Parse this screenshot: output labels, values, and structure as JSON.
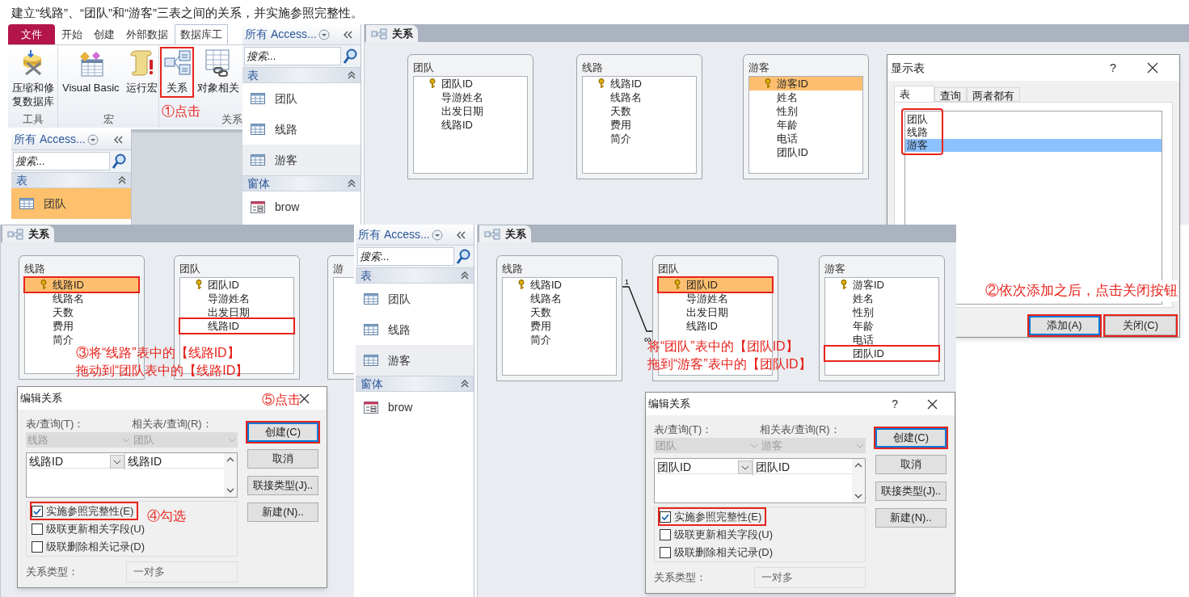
{
  "instruction": "建立“线路”、“团队”和“游客”三表之间的关系，并实施参照完整性。",
  "ribbon": {
    "tabs": [
      {
        "label": "文件",
        "kind": "file"
      },
      {
        "label": "开始",
        "kind": "tab",
        "selected": false
      },
      {
        "label": "创建",
        "kind": "tab",
        "selected": false
      },
      {
        "label": "外部数据",
        "kind": "tab",
        "selected": false
      },
      {
        "label": "数据库工",
        "kind": "tab",
        "selected": true
      }
    ],
    "groups": [
      {
        "label": "工具",
        "buttons": [
          {
            "label": "压缩和修复数据库",
            "kind": "compact",
            "highlighted": false
          }
        ]
      },
      {
        "label": "宏",
        "buttons": [
          {
            "label": "Visual Basic",
            "kind": "vb",
            "highlighted": false
          },
          {
            "label": "运行宏",
            "kind": "macro",
            "highlighted": false
          }
        ]
      },
      {
        "label": "关系",
        "buttons": [
          {
            "label": "关系",
            "kind": "relations",
            "highlighted": true
          },
          {
            "label": "对象相关",
            "kind": "dependencies",
            "highlighted": false
          }
        ]
      }
    ],
    "annotation": "①点击"
  },
  "nav_panes": [
    {
      "title": "所有 Access...",
      "search_placeholder": "搜索...",
      "sections": [
        {
          "label": "表",
          "items": [
            {
              "label": "团队",
              "kind": "table",
              "selected": true
            }
          ]
        }
      ]
    },
    {
      "title": "所有 Access...",
      "search_placeholder": "搜索...",
      "sections": [
        {
          "label": "表",
          "items": [
            {
              "label": "团队",
              "kind": "table",
              "selected": false,
              "hovered": false
            },
            {
              "label": "线路",
              "kind": "table",
              "selected": false,
              "hovered": false
            },
            {
              "label": "游客",
              "kind": "table",
              "selected": false,
              "hovered": true
            }
          ]
        },
        {
          "label": "窗体",
          "items": [
            {
              "label": "brow",
              "kind": "form",
              "selected": false,
              "hovered": false
            }
          ]
        }
      ]
    },
    {
      "title": "所有 Access...",
      "search_placeholder": "搜索...",
      "sections": [
        {
          "label": "表",
          "items": [
            {
              "label": "团队",
              "kind": "table",
              "selected": false,
              "hovered": false
            },
            {
              "label": "线路",
              "kind": "table",
              "selected": false,
              "hovered": false
            },
            {
              "label": "游客",
              "kind": "table",
              "selected": false,
              "hovered": true
            }
          ]
        },
        {
          "label": "窗体",
          "items": [
            {
              "label": "brow",
              "kind": "form",
              "selected": false,
              "hovered": false
            }
          ]
        }
      ]
    }
  ],
  "relationship_windows": [
    {
      "tab": "关系",
      "tables": [
        {
          "name": "团队",
          "fields": [
            {
              "label": "团队ID",
              "key": true,
              "selected": false,
              "highlighted": false
            },
            {
              "label": "导游姓名",
              "key": false,
              "selected": false,
              "highlighted": false
            },
            {
              "label": "出发日期",
              "key": false,
              "selected": false,
              "highlighted": false
            },
            {
              "label": "线路ID",
              "key": false,
              "selected": false,
              "highlighted": false
            }
          ]
        },
        {
          "name": "线路",
          "fields": [
            {
              "label": "线路ID",
              "key": true,
              "selected": false,
              "highlighted": false
            },
            {
              "label": "线路名",
              "key": false,
              "selected": false,
              "highlighted": false
            },
            {
              "label": "天数",
              "key": false,
              "selected": false,
              "highlighted": false
            },
            {
              "label": "费用",
              "key": false,
              "selected": false,
              "highlighted": false
            },
            {
              "label": "简介",
              "key": false,
              "selected": false,
              "highlighted": false
            }
          ]
        },
        {
          "name": "游客",
          "fields": [
            {
              "label": "游客ID",
              "key": true,
              "selected": true,
              "highlighted": false
            },
            {
              "label": "姓名",
              "key": false,
              "selected": false,
              "highlighted": false
            },
            {
              "label": "性别",
              "key": false,
              "selected": false,
              "highlighted": false
            },
            {
              "label": "年龄",
              "key": false,
              "selected": false,
              "highlighted": false
            },
            {
              "label": "电话",
              "key": false,
              "selected": false,
              "highlighted": false
            },
            {
              "label": "团队ID",
              "key": false,
              "selected": false,
              "highlighted": false
            }
          ]
        }
      ]
    },
    {
      "tab": "关系",
      "tables": [
        {
          "name": "线路",
          "fields": [
            {
              "label": "线路ID",
              "key": true,
              "selected": true,
              "highlighted": true
            },
            {
              "label": "线路名",
              "key": false,
              "selected": false,
              "highlighted": false
            },
            {
              "label": "天数",
              "key": false,
              "selected": false,
              "highlighted": false
            },
            {
              "label": "费用",
              "key": false,
              "selected": false,
              "highlighted": false
            },
            {
              "label": "简介",
              "key": false,
              "selected": false,
              "highlighted": false
            }
          ]
        },
        {
          "name": "团队",
          "fields": [
            {
              "label": "团队ID",
              "key": true,
              "selected": false,
              "highlighted": false
            },
            {
              "label": "导游姓名",
              "key": false,
              "selected": false,
              "highlighted": false
            },
            {
              "label": "出发日期",
              "key": false,
              "selected": false,
              "highlighted": false
            },
            {
              "label": "线路ID",
              "key": false,
              "selected": false,
              "highlighted": true
            }
          ]
        },
        {
          "name": "游"
        }
      ],
      "annotation": [
        "③将“线路”表中的【线路ID】",
        "拖动到“团队表中的【线路ID】"
      ],
      "edit_dialog": {
        "title": "编辑关系",
        "table_label": "表/查询(T)：",
        "related_label": "相关表/查询(R)：",
        "table_value": "线路",
        "related_value": "团队",
        "grid_rows": [
          {
            "left": "线路ID",
            "right": "线路ID"
          }
        ],
        "options": [
          {
            "label": "实施参照完整性(E)",
            "checked": true,
            "highlighted": true
          },
          {
            "label": "级联更新相关字段(U)",
            "checked": false,
            "highlighted": false
          },
          {
            "label": "级联删除相关记录(D)",
            "checked": false,
            "highlighted": false
          }
        ],
        "type_label": "关系类型：",
        "type_value": "一对多",
        "buttons": [
          {
            "label": "创建(C)",
            "default": true,
            "highlighted": true
          },
          {
            "label": "取消",
            "default": false,
            "highlighted": false
          },
          {
            "label": "联接类型(J)..",
            "default": false,
            "highlighted": false
          },
          {
            "label": "新建(N)..",
            "default": false,
            "highlighted": false
          }
        ],
        "button_note": "⑤点击",
        "option_note": "④勾选"
      }
    },
    {
      "tab": "关系",
      "tables": [
        {
          "name": "线路",
          "fields": [
            {
              "label": "线路ID",
              "key": true,
              "selected": false,
              "highlighted": false
            },
            {
              "label": "线路名",
              "key": false,
              "selected": false,
              "highlighted": false
            },
            {
              "label": "天数",
              "key": false,
              "selected": false,
              "highlighted": false
            },
            {
              "label": "费用",
              "key": false,
              "selected": false,
              "highlighted": false
            },
            {
              "label": "简介",
              "key": false,
              "selected": false,
              "highlighted": false
            }
          ]
        },
        {
          "name": "团队",
          "fields": [
            {
              "label": "团队ID",
              "key": true,
              "selected": true,
              "highlighted": true
            },
            {
              "label": "导游姓名",
              "key": false,
              "selected": false,
              "highlighted": false
            },
            {
              "label": "出发日期",
              "key": false,
              "selected": false,
              "highlighted": false
            },
            {
              "label": "线路ID",
              "key": false,
              "selected": false,
              "highlighted": false
            }
          ]
        },
        {
          "name": "游客",
          "fields": [
            {
              "label": "游客ID",
              "key": true,
              "selected": false,
              "highlighted": false
            },
            {
              "label": "姓名",
              "key": false,
              "selected": false,
              "highlighted": false
            },
            {
              "label": "性别",
              "key": false,
              "selected": false,
              "highlighted": false
            },
            {
              "label": "年龄",
              "key": false,
              "selected": false,
              "highlighted": false
            },
            {
              "label": "电话",
              "key": false,
              "selected": false,
              "highlighted": false
            },
            {
              "label": "团队ID",
              "key": false,
              "selected": false,
              "highlighted": true
            }
          ]
        }
      ],
      "relationship": {
        "one_label": "1",
        "many_label": "∞"
      },
      "annotation": [
        "将“团队”表中的【团队ID】",
        "拖到“游客”表中的【团队ID】"
      ],
      "edit_dialog": {
        "title": "编辑关系",
        "help": "?",
        "table_label": "表/查询(T)：",
        "related_label": "相关表/查询(R)：",
        "table_value": "团队",
        "related_value": "游客",
        "grid_rows": [
          {
            "left": "团队ID",
            "right": "团队ID"
          }
        ],
        "options": [
          {
            "label": "实施参照完整性(E)",
            "checked": true,
            "highlighted": true
          },
          {
            "label": "级联更新相关字段(U)",
            "checked": false,
            "highlighted": false
          },
          {
            "label": "级联删除相关记录(D)",
            "checked": false,
            "highlighted": false
          }
        ],
        "type_label": "关系类型：",
        "type_value": "一对多",
        "buttons": [
          {
            "label": "创建(C)",
            "default": true,
            "highlighted": true
          },
          {
            "label": "取消",
            "default": false,
            "highlighted": false
          },
          {
            "label": "联接类型(J)..",
            "default": false,
            "highlighted": false
          },
          {
            "label": "新建(N)..",
            "default": false,
            "highlighted": false
          }
        ]
      }
    }
  ],
  "show_table_dialog": {
    "title": "显示表",
    "help": "?",
    "tabs": [
      {
        "label": "表",
        "selected": true
      },
      {
        "label": "查询",
        "selected": false
      },
      {
        "label": "两者都有",
        "selected": false
      }
    ],
    "items": [
      {
        "label": "团队",
        "selected": false
      },
      {
        "label": "线路",
        "selected": false
      },
      {
        "label": "游客",
        "selected": true
      }
    ],
    "list_highlighted": true,
    "buttons": [
      {
        "label": "添加(A)",
        "default": true,
        "highlighted": true
      },
      {
        "label": "关闭(C)",
        "default": false,
        "highlighted": true
      }
    ],
    "annotation": "②依次添加之后，点击关闭按钮"
  }
}
